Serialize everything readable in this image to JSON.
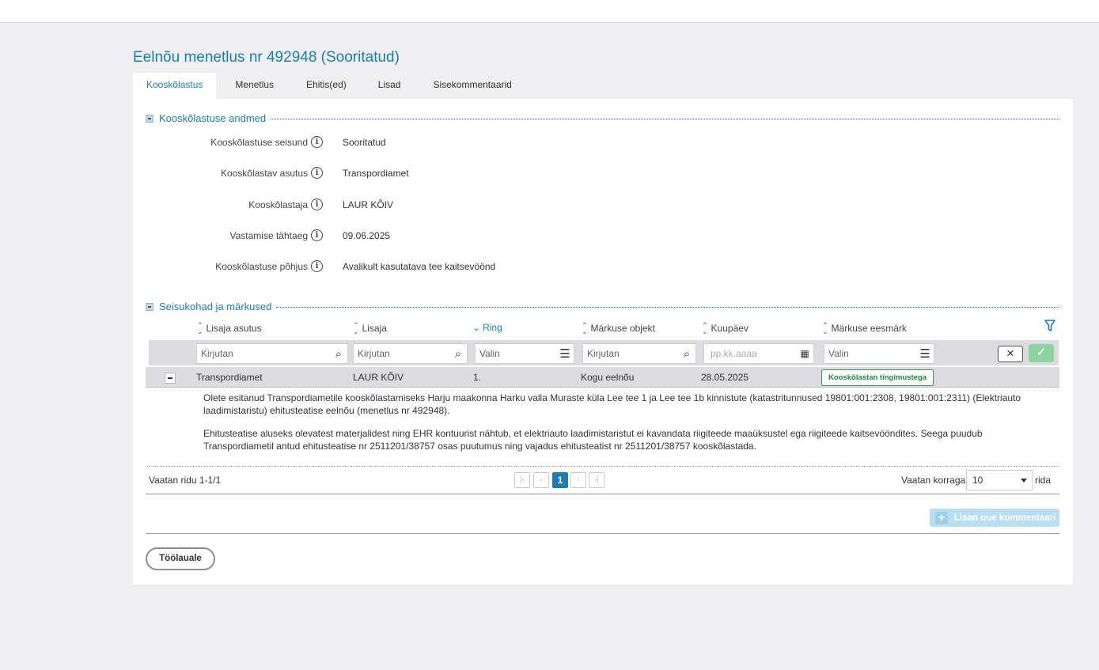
{
  "page": {
    "title": "Eelnõu menetlus nr 492948 (Sooritatud)"
  },
  "tabs": [
    {
      "label": "Kooskõlastus",
      "active": true
    },
    {
      "label": "Menetlus",
      "active": false
    },
    {
      "label": "Ehitis(ed)",
      "active": false
    },
    {
      "label": "Lisad",
      "active": false
    },
    {
      "label": "Sisekommentaarid",
      "active": false
    }
  ],
  "section1": {
    "title": "Kooskõlastuse andmed",
    "fields": [
      {
        "label": "Kooskõlastuse seisund",
        "value": "Sooritatud"
      },
      {
        "label": "Kooskõlastav asutus",
        "value": "Transpordiamet"
      },
      {
        "label": "Kooskõlastaja",
        "value": "LAUR KÕIV"
      },
      {
        "label": "Vastamise tähtaeg",
        "value": "09.06.2025"
      },
      {
        "label": "Kooskõlastuse põhjus",
        "value": "Avalikult kasutatava tee kaitsevöönd"
      }
    ]
  },
  "section2": {
    "title": "Seisukohad ja märkused",
    "columns": [
      {
        "label": "Lisaja asutus"
      },
      {
        "label": "Lisaja"
      },
      {
        "label": "Ring"
      },
      {
        "label": "Märkuse objekt"
      },
      {
        "label": "Kuupäev"
      },
      {
        "label": "Märkuse eesmärk"
      }
    ],
    "filters": {
      "lisaja_asutus": "Kirjutan",
      "lisaja": "Kirjutan",
      "ring": "Valin",
      "objekt": "Kirjutan",
      "kuupaev": "pp.kk.aaaa",
      "eesmark": "Valin"
    },
    "row": {
      "asutus": "Transpordiamet",
      "lisaja": "LAUR KÕIV",
      "ring": "1.",
      "objekt": "Kogu eelnõu",
      "kuupaev": "28.05.2025",
      "eesmark": "Kooskõlastan tingimustega"
    },
    "comment_p1": "Olete esitanud Transpordiametile kooskõlastamiseks Harju maakonna Harku valla Muraste küla Lee tee 1 ja Lee tee 1b kinnistute (katastritunnused 19801:001:2308, 19801:001:2311) (Elektriauto laadimistaristu) ehitusteatise eelnõu (menetlus nr 492948).",
    "comment_p2": "Ehitusteatise aluseks olevatest materjalidest ning EHR kontuurist nähtub, et elektriauto laadimistaristut ei kavandata riigiteede maaüksustel ega riigiteede kaitsevööndites. Seega puudub Transpordiametil antud ehitusteatise nr 2511201/38757 osas puutumus ning vajadus ehitusteatist nr 2511201/38757 kooskõlastada.",
    "pager": {
      "summary": "Vaatan ridu 1-1/1",
      "current_page": "1",
      "per_page_label": "Vaatan korraga",
      "per_page_value": "10",
      "rows_suffix": "rida"
    },
    "add_comment_label": "Lisan uue kommentaari"
  },
  "back_label": "Töölauale",
  "colors": {
    "accent": "#1a7fb0",
    "success": "#29a24a",
    "background": "#efeff1"
  }
}
